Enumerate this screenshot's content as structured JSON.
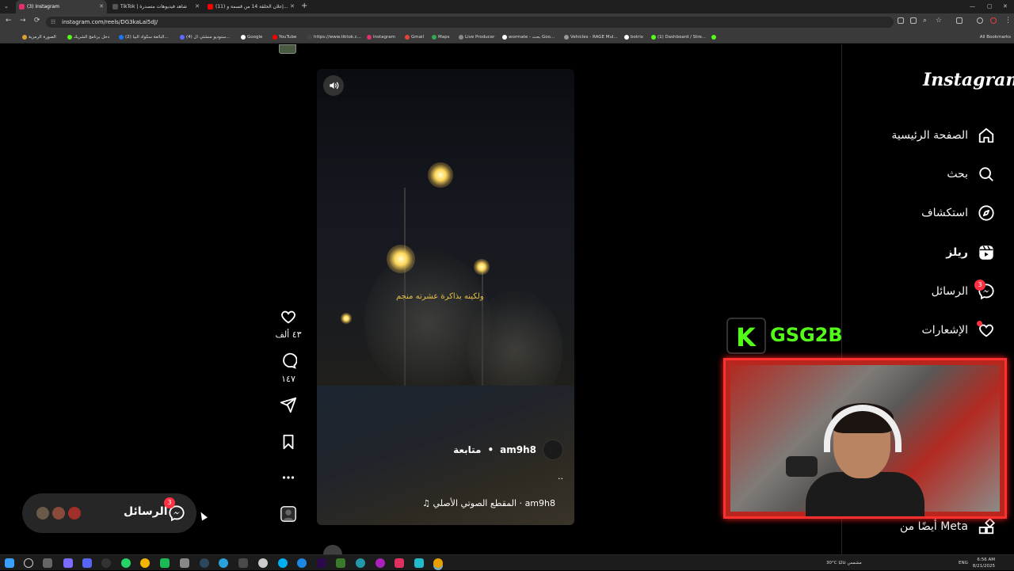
{
  "browser": {
    "tabs": [
      {
        "label": "(3) Instagram",
        "active": true,
        "color": "#e1306c"
      },
      {
        "label": "TikTok | شاهد فيديوهات متصدرة",
        "active": false,
        "color": "#111111"
      },
      {
        "label": "(11) إعلان الحلقة 14 من قسمة و...",
        "active": false,
        "color": "#ff0000"
      }
    ],
    "url": "instagram.com/reels/DG3kaLai5dJ/",
    "bookmarks": [
      {
        "label": "الصورة الرمزية",
        "color": "#e0a030"
      },
      {
        "label": "دخل برنامج الشريك",
        "color": "#53fc18"
      },
      {
        "label": "(2) البائعة سكواد البيا...",
        "color": "#1877f2"
      },
      {
        "label": "(4) ستوديو منشئي ال...",
        "color": "#5b6cff"
      },
      {
        "label": "Google",
        "color": "#ffffff"
      },
      {
        "label": "YouTube",
        "color": "#ff0000"
      },
      {
        "label": "https://www.tiktok.c...",
        "color": "#111111"
      },
      {
        "label": "Instagram",
        "color": "#e1306c"
      },
      {
        "label": "Gmail",
        "color": "#ea4335"
      },
      {
        "label": "Maps",
        "color": "#34a853"
      },
      {
        "label": "Live Producer",
        "color": "#888888"
      },
      {
        "label": "wormate - بحث Goo...",
        "color": "#ffffff"
      },
      {
        "label": "Vehicles - RAGE Mul...",
        "color": "#999999"
      },
      {
        "label": "botrix",
        "color": "#ffffff"
      },
      {
        "label": "(1) Dashboard / Stre...",
        "color": "#53fc18"
      }
    ],
    "all_bookmarks": "All Bookmarks"
  },
  "instagram": {
    "logo": "Instagram",
    "nav": [
      {
        "label": "الصفحة الرئيسية",
        "icon": "home-icon"
      },
      {
        "label": "بحث",
        "icon": "search-icon"
      },
      {
        "label": "استكشاف",
        "icon": "compass-icon"
      },
      {
        "label": "ريلز",
        "icon": "reels-icon"
      },
      {
        "label": "الرسائل",
        "icon": "messenger-icon",
        "badge": "3"
      },
      {
        "label": "الإشعارات",
        "icon": "heart-icon",
        "dot": true
      }
    ],
    "also_from_meta": "أيضًا من Meta",
    "reel": {
      "caption_overlay": "ولكينه بذاكرة عشرته منجم",
      "username": "am9h8",
      "follow_label": "متابعة",
      "separator": "•",
      "more_text": "..",
      "audio_label": "♫ المقطع الصوتي الأصلي · am9h8"
    },
    "actions": {
      "likes": "٤٣ ألف",
      "comments": "١٤٧"
    },
    "messages_pill": {
      "label": "الرسائل",
      "badge": "3"
    }
  },
  "stream_overlay": {
    "k_letter": "K",
    "name": "GSG2B",
    "accent": "#53fc18",
    "frame_color": "#ff3030"
  },
  "taskbar": {
    "weather": "30°C مشمس غالبًا",
    "lang": "ENG",
    "time": "6:56 AM",
    "date": "8/21/2025"
  }
}
